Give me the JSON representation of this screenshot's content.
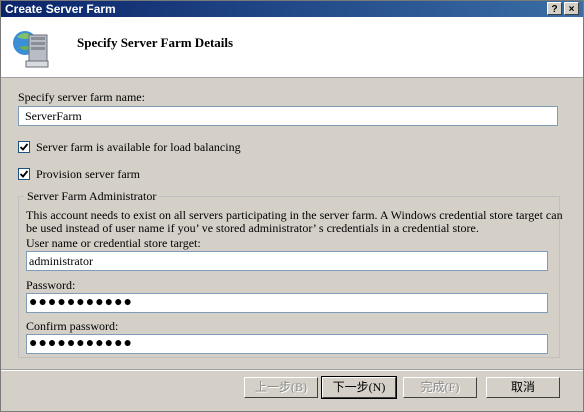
{
  "window": {
    "title": "Create Server Farm",
    "help_button": "?",
    "close_button": "×"
  },
  "header": {
    "title": "Specify Server Farm Details",
    "icon": "server-computer-icon"
  },
  "form": {
    "name_label": "Specify server farm name:",
    "name_value": "ServerFarm",
    "load_balancing_label": "Server farm is available for load balancing",
    "load_balancing_checked": true,
    "provision_label": "Provision server farm",
    "provision_checked": true
  },
  "admin_group": {
    "legend": "Server Farm Administrator",
    "description_line1": "This account needs to exist on all servers participating in the server farm. A Windows credential store target can",
    "description_line2": "be used instead of user name if you’ ve stored administrator’ s credentials in a credential store.",
    "username_label": "User name or credential store target:",
    "username_value": "administrator",
    "password_label": "Password:",
    "password_value": "●●●●●●●●●●●",
    "confirm_label": "Confirm password:",
    "confirm_value": "●●●●●●●●●●●"
  },
  "buttons": {
    "back": "上一步(B)",
    "next": "下一步(N)",
    "finish": "完成(F)",
    "cancel": "取消"
  }
}
